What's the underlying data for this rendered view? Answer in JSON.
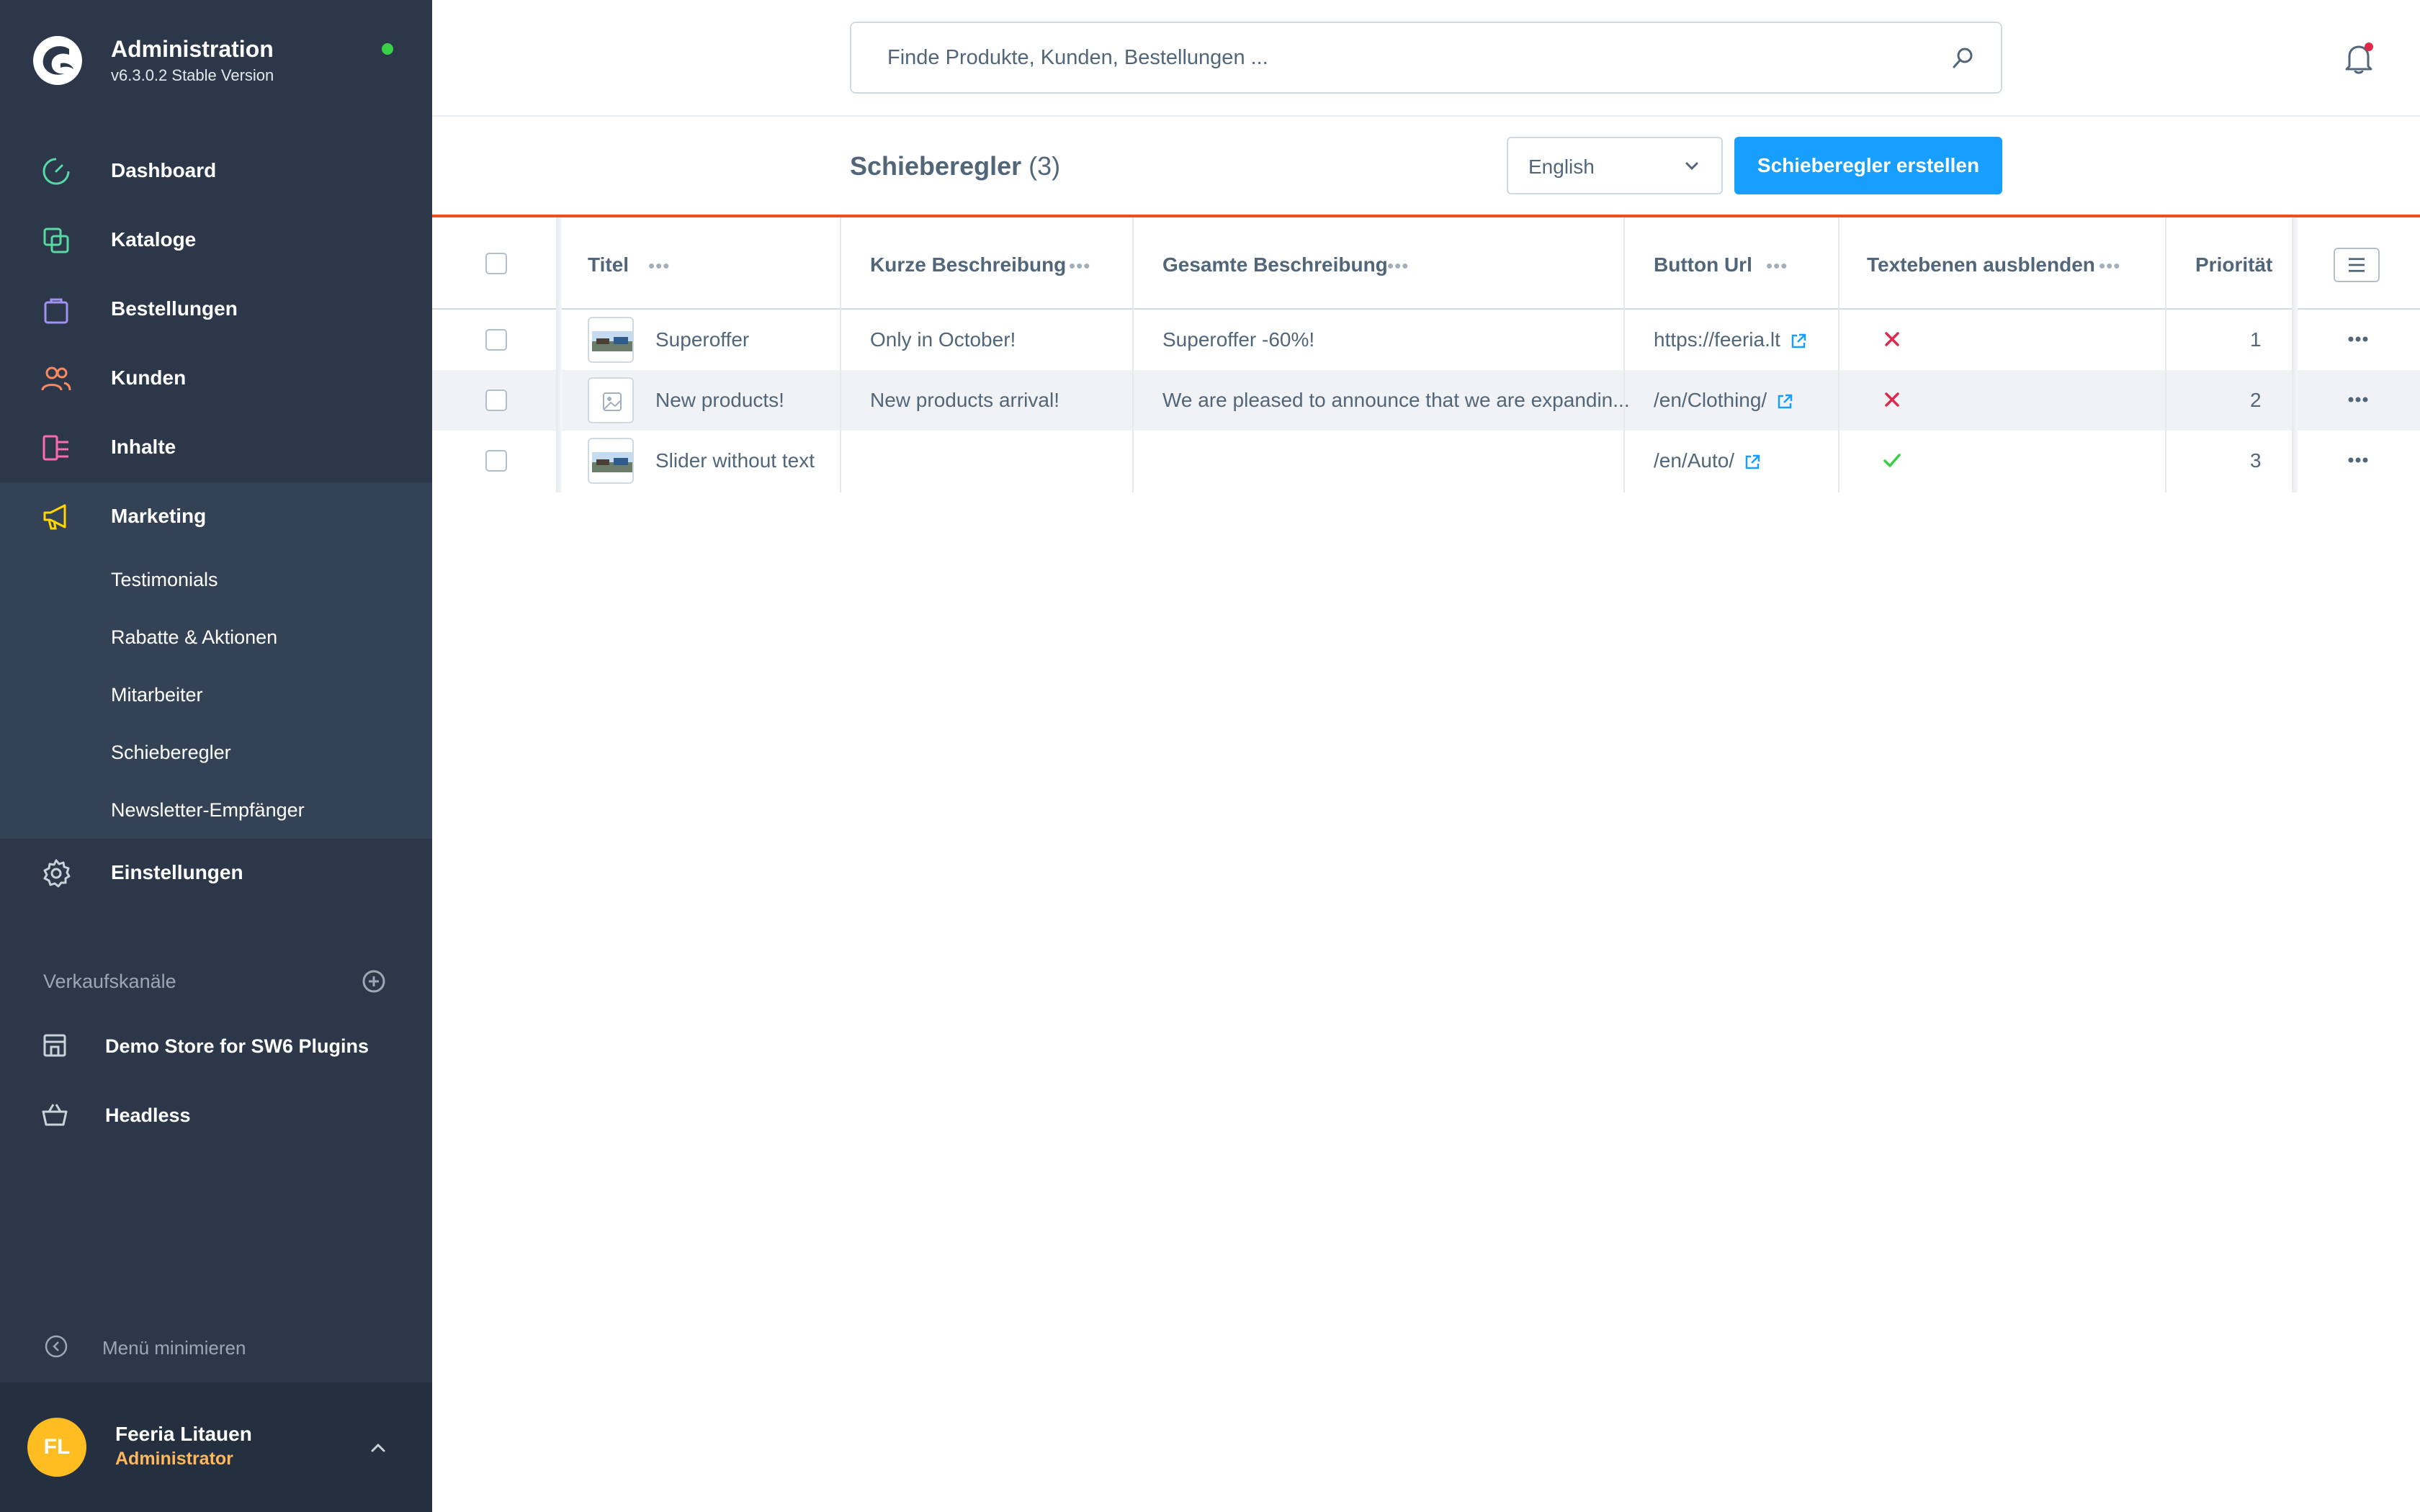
{
  "brand": {
    "title": "Administration",
    "version": "v6.3.0.2 Stable Version"
  },
  "nav": {
    "dashboard": "Dashboard",
    "catalogs": "Kataloge",
    "orders": "Bestellungen",
    "customers": "Kunden",
    "content": "Inhalte",
    "marketing": "Marketing",
    "marketing_sub": [
      "Testimonials",
      "Rabatte & Aktionen",
      "Mitarbeiter",
      "Schieberegler",
      "Newsletter-Empfänger"
    ],
    "settings": "Einstellungen"
  },
  "sales_channels": {
    "heading": "Verkaufskanäle",
    "items": [
      "Demo Store for SW6 Plugins",
      "Headless"
    ]
  },
  "minimize_label": "Menü minimieren",
  "user": {
    "initials": "FL",
    "name": "Feeria Litauen",
    "role": "Administrator"
  },
  "search": {
    "placeholder": "Finde Produkte, Kunden, Bestellungen ..."
  },
  "page": {
    "title": "Schieberegler",
    "count": "(3)"
  },
  "language": {
    "selected": "English"
  },
  "create_button": "Schieberegler erstellen",
  "grid": {
    "columns": [
      "Titel",
      "Kurze Beschreibung",
      "Gesamte Beschreibung",
      "Button Url",
      "Textebenen ausblenden",
      "Priorität"
    ],
    "rows": [
      {
        "title": "Superoffer",
        "short": "Only in October!",
        "full": "Superoffer -60%!",
        "url": "https://feeria.lt",
        "hide_text": false,
        "priority": "1",
        "thumb": "image"
      },
      {
        "title": "New products!",
        "short": "New products arrival!",
        "full": "We are pleased to announce that we are expandin...",
        "url": "/en/Clothing/",
        "hide_text": false,
        "priority": "2",
        "thumb": "placeholder"
      },
      {
        "title": "Slider without text",
        "short": "",
        "full": "",
        "url": "/en/Auto/",
        "hide_text": true,
        "priority": "3",
        "thumb": "image"
      }
    ]
  },
  "colors": {
    "sidebar": "#2c3849",
    "primary": "#189eff",
    "accent_line": "#ef4f1e",
    "error": "#de294c",
    "success": "#37d046",
    "avatar": "#ffbd21"
  }
}
